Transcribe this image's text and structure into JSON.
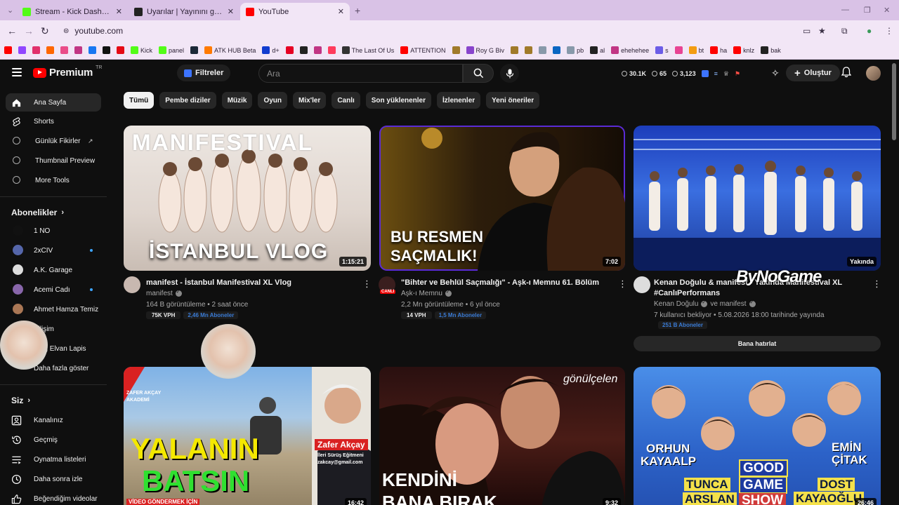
{
  "browser": {
    "tabs": [
      {
        "label": "Stream - Kick Dashboard",
        "color": "#53fc18"
      },
      {
        "label": "Uyarılar | Yayınını güçlendirmek",
        "color": "#222222"
      },
      {
        "label": "YouTube",
        "color": "#ff0000"
      }
    ],
    "url": "youtube.com",
    "bookmarks": [
      {
        "label": "",
        "color": "#ff0000"
      },
      {
        "label": "",
        "color": "#9146ff"
      },
      {
        "label": "",
        "color": "#e1306c"
      },
      {
        "label": "",
        "color": "#ff6600"
      },
      {
        "label": "",
        "color": "#ea4c89"
      },
      {
        "label": "",
        "color": "#c13584"
      },
      {
        "label": "",
        "color": "#1877f2"
      },
      {
        "label": "",
        "color": "#111111"
      },
      {
        "label": "",
        "color": "#e50914"
      },
      {
        "label": "Kick",
        "color": "#53fc18"
      },
      {
        "label": "panel",
        "color": "#53fc18"
      },
      {
        "label": "",
        "color": "#1b2838"
      },
      {
        "label": "ATK HUB Beta",
        "color": "#ff7a00"
      },
      {
        "label": "d+",
        "color": "#113ccf"
      },
      {
        "label": "",
        "color": "#e60023"
      },
      {
        "label": "",
        "color": "#222222"
      },
      {
        "label": "",
        "color": "#c13584"
      },
      {
        "label": "",
        "color": "#ff3b5c"
      },
      {
        "label": "The Last Of Us",
        "color": "#333333"
      },
      {
        "label": "ATTENTION",
        "color": "#ff0000"
      },
      {
        "label": "",
        "color": "#a07a2a"
      },
      {
        "label": "Roy G Biv",
        "color": "#8844cc"
      },
      {
        "label": "",
        "color": "#a07a2a"
      },
      {
        "label": "",
        "color": "#a07a2a"
      },
      {
        "label": "",
        "color": "#8899aa"
      },
      {
        "label": "",
        "color": "#0a66c2"
      },
      {
        "label": "pb",
        "color": "#8899aa"
      },
      {
        "label": "al",
        "color": "#222222"
      },
      {
        "label": "ehehehee",
        "color": "#c13584"
      },
      {
        "label": "s",
        "color": "#6c5ce7"
      },
      {
        "label": "",
        "color": "#e84393"
      },
      {
        "label": "bt",
        "color": "#f39c12"
      },
      {
        "label": "ha",
        "color": "#ff0000"
      },
      {
        "label": "knlz",
        "color": "#ff0000"
      },
      {
        "label": "bak",
        "color": "#222222"
      }
    ]
  },
  "header": {
    "brand": "Premium",
    "country": "TR",
    "filters_label": "Filtreler",
    "search_placeholder": "Ara",
    "stats": [
      "30.1K",
      "65",
      "3,123"
    ],
    "create_label": "Oluştur"
  },
  "sidebar": {
    "main": [
      {
        "label": "Ana Sayfa",
        "icon": "home-icon"
      },
      {
        "label": "Shorts",
        "icon": "shorts-icon"
      },
      {
        "label": "Günlük Fikirler",
        "icon": "ideas-icon"
      },
      {
        "label": "Thumbnail Preview",
        "icon": "thumbnail-icon"
      },
      {
        "label": "More Tools",
        "icon": "tools-icon"
      }
    ],
    "subs_title": "Abonelikler",
    "subscriptions": [
      {
        "label": "1 NO",
        "color": "#111111",
        "dot": false
      },
      {
        "label": "2xCIV",
        "color": "#5566aa",
        "dot": true
      },
      {
        "label": "A.K. Garage",
        "color": "#dddddd",
        "dot": false
      },
      {
        "label": "Acemi Cadı",
        "color": "#8866aa",
        "dot": true
      },
      {
        "label": "Ahmet Hamza Temiz",
        "color": "#aa7755",
        "dot": false
      },
      {
        "label": "Bilişim",
        "color": "#5577aa",
        "dot": false
      },
      {
        "label": "Blog Elvan Lapis",
        "color": "#cc8899",
        "dot": false
      }
    ],
    "show_more": "Daha fazla göster",
    "you_title": "Siz",
    "you_items": [
      {
        "label": "Kanalınız",
        "icon": "channel-icon"
      },
      {
        "label": "Geçmiş",
        "icon": "history-icon"
      },
      {
        "label": "Oynatma listeleri",
        "icon": "playlists-icon"
      },
      {
        "label": "Daha sonra izle",
        "icon": "watch-later-icon"
      },
      {
        "label": "Beğendiğim videolar",
        "icon": "liked-icon"
      }
    ]
  },
  "chips": [
    "Tümü",
    "Pembe diziler",
    "Müzik",
    "Oyun",
    "Mix'ler",
    "Canlı",
    "Son yüklenenler",
    "İzlenenler",
    "Yeni öneriler"
  ],
  "videos": [
    {
      "thumb_text": [
        "MANIFESTIVAL",
        "İSTANBUL VLOG"
      ],
      "duration": "1:15:21",
      "title": "manifest - İstanbul Manifestival XL Vlog",
      "channel": "manifest",
      "meta": "164 B görüntüleme • 2 saat önce",
      "vph": "75K VPH",
      "subs": "2,46 Mn Aboneler"
    },
    {
      "thumb_text": [
        "BU RESMEN",
        "SAÇMALIK!"
      ],
      "duration": "7:02",
      "title": "\"Bihter ve Behlül Saçmalığı\" - Aşk-ı Memnu 61. Bölüm",
      "channel": "Aşk-ı Memnu",
      "live_badge": "CANLI",
      "meta": "2,2 Mn görüntüleme • 6 yıl önce",
      "vph": "14 VPH",
      "subs": "1,5 Mn Aboneler"
    },
    {
      "duration": "Yakında",
      "title": "Kenan Doğulu & manifest - Yakında Manifestival XL #CanlıPerformans",
      "channel": "Kenan Doğulu",
      "channel_and": "ve manifest",
      "meta": "7 kullanıcı bekliyor • 5.08.2026 18:00 tarihinde yayında",
      "subs": "251 B Aboneler",
      "remind": "Bana hatırlat"
    },
    {
      "thumb_text": [
        "YALANIN",
        "BATSIN",
        "Zafer Akçay",
        "İleri Sürüş Eğitmeni",
        "zakcay@gmail.com",
        "VİDEO GÖNDERMEK İÇİN",
        "ZAFER AKÇAY",
        "AKADEMİ"
      ],
      "duration": "16:42"
    },
    {
      "thumb_text": [
        "KENDİNİ",
        "BANA BIRAK",
        "gönülçelen"
      ],
      "duration": "9:32"
    },
    {
      "thumb_text": [
        "ORHUN",
        "KAYAALP",
        "EMİN",
        "ÇİTAK",
        "TUNCA",
        "ARSLAN",
        "GOOD",
        "GAME",
        "SHOW",
        "DOST",
        "KAYAOĞLU"
      ],
      "duration": "26:46"
    }
  ],
  "watermark": "ByNoGame"
}
